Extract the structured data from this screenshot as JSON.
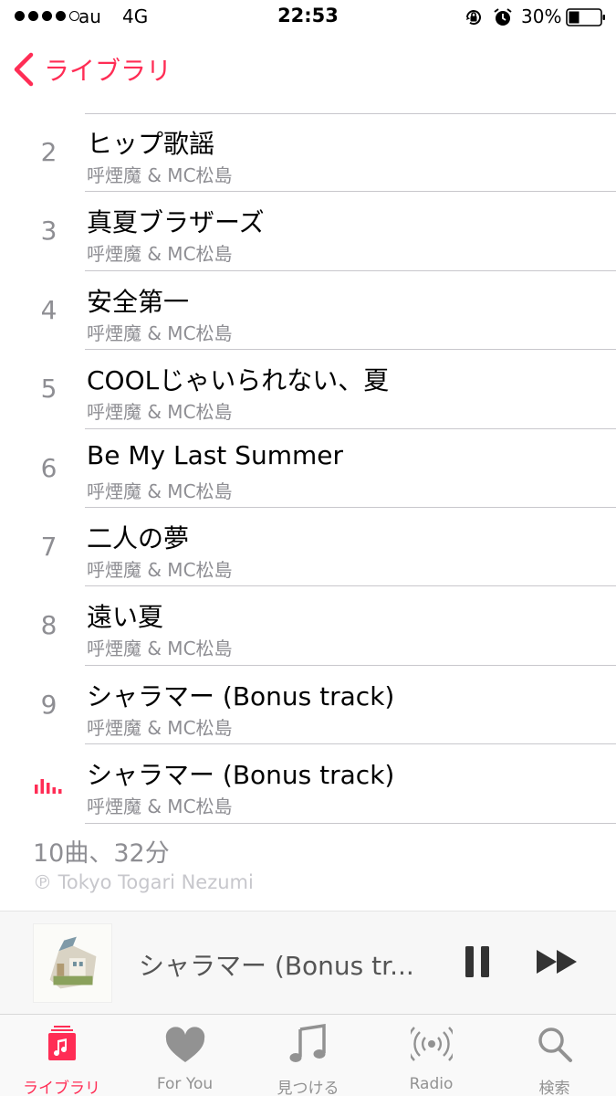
{
  "status_bar": {
    "carrier": "au",
    "network": "4G",
    "time": "22:53",
    "battery": "30%"
  },
  "nav": {
    "back_label": "ライブラリ"
  },
  "tracks": [
    {
      "number": "2",
      "title": "ヒップ歌謡",
      "artist": "呼煙魔 & MC松島"
    },
    {
      "number": "3",
      "title": "真夏ブラザーズ",
      "artist": "呼煙魔 & MC松島"
    },
    {
      "number": "4",
      "title": "安全第一",
      "artist": "呼煙魔 & MC松島"
    },
    {
      "number": "5",
      "title": "COOLじゃいられない、夏",
      "artist": "呼煙魔 & MC松島"
    },
    {
      "number": "6",
      "title": "Be My Last Summer",
      "artist": "呼煙魔 & MC松島"
    },
    {
      "number": "7",
      "title": "二人の夢",
      "artist": "呼煙魔 & MC松島"
    },
    {
      "number": "8",
      "title": "遠い夏",
      "artist": "呼煙魔 & MC松島"
    },
    {
      "number": "9",
      "title": "シャラマー (Bonus track)",
      "artist": "呼煙魔 & MC松島"
    },
    {
      "number": "",
      "title": "シャラマー (Bonus track)",
      "artist": "呼煙魔 & MC松島",
      "playing": true
    }
  ],
  "summary": "10曲、32分",
  "copyright": "℗ Tokyo Togari Nezumi",
  "now_playing": {
    "title": "シャラマー (Bonus tr..."
  },
  "tabs": [
    {
      "label": "ライブラリ",
      "icon": "library-icon",
      "active": true
    },
    {
      "label": "For You",
      "icon": "heart-icon"
    },
    {
      "label": "見つける",
      "icon": "music-note-icon"
    },
    {
      "label": "Radio",
      "icon": "radio-icon"
    },
    {
      "label": "検索",
      "icon": "search-icon"
    }
  ],
  "colors": {
    "accent": "#ff2d55",
    "secondary_text": "#8e8e93",
    "separator": "#c8c7cc"
  }
}
